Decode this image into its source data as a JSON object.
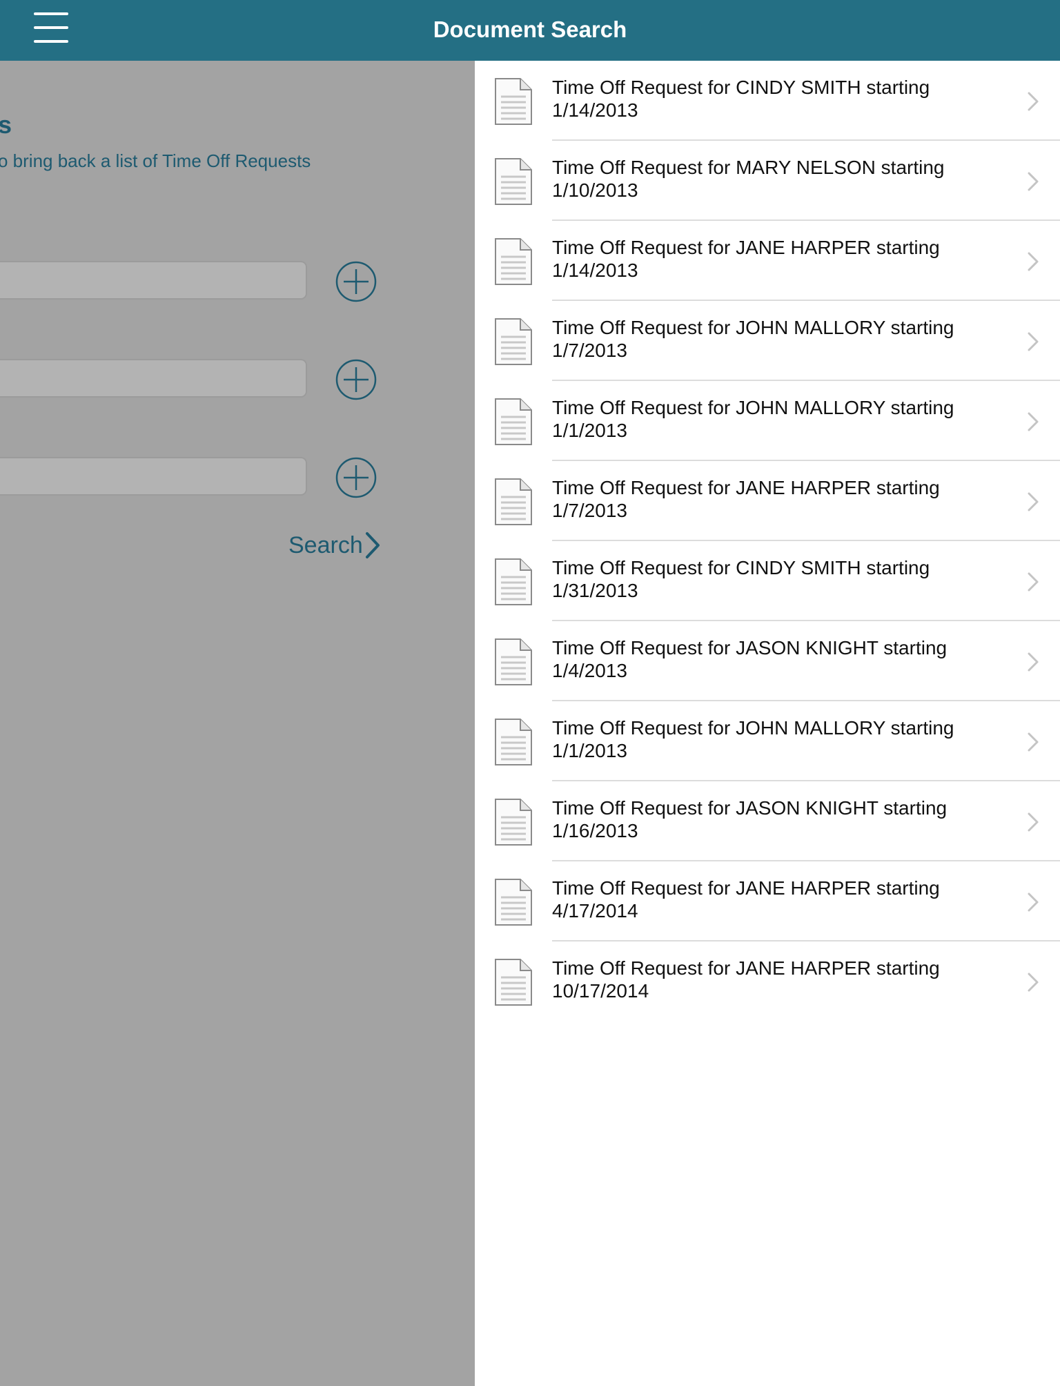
{
  "header": {
    "title": "Document Search"
  },
  "left_panel": {
    "heading": "s",
    "subtitle": "o bring back a list of Time Off Requests",
    "search_label": "Search"
  },
  "results": [
    {
      "title": "Time Off Request for CINDY SMITH starting",
      "date": "1/14/2013"
    },
    {
      "title": "Time Off Request for MARY NELSON starting",
      "date": "1/10/2013"
    },
    {
      "title": "Time Off Request for JANE HARPER starting",
      "date": "1/14/2013"
    },
    {
      "title": "Time Off Request for JOHN MALLORY starting",
      "date": "1/7/2013"
    },
    {
      "title": "Time Off Request for JOHN MALLORY starting",
      "date": "1/1/2013"
    },
    {
      "title": "Time Off Request for JANE HARPER starting",
      "date": "1/7/2013"
    },
    {
      "title": "Time Off Request for CINDY SMITH starting",
      "date": "1/31/2013"
    },
    {
      "title": "Time Off Request for JASON KNIGHT starting",
      "date": "1/4/2013"
    },
    {
      "title": "Time Off Request for JOHN MALLORY starting",
      "date": "1/1/2013"
    },
    {
      "title": "Time Off Request for JASON KNIGHT starting",
      "date": "1/16/2013"
    },
    {
      "title": "Time Off Request for JANE HARPER starting",
      "date": "4/17/2014"
    },
    {
      "title": "Time Off Request for JANE HARPER starting",
      "date": "10/17/2014"
    }
  ],
  "colors": {
    "navbar": "#246f84",
    "accent": "#1d5a70",
    "dim_overlay": "#a3a3a3"
  }
}
